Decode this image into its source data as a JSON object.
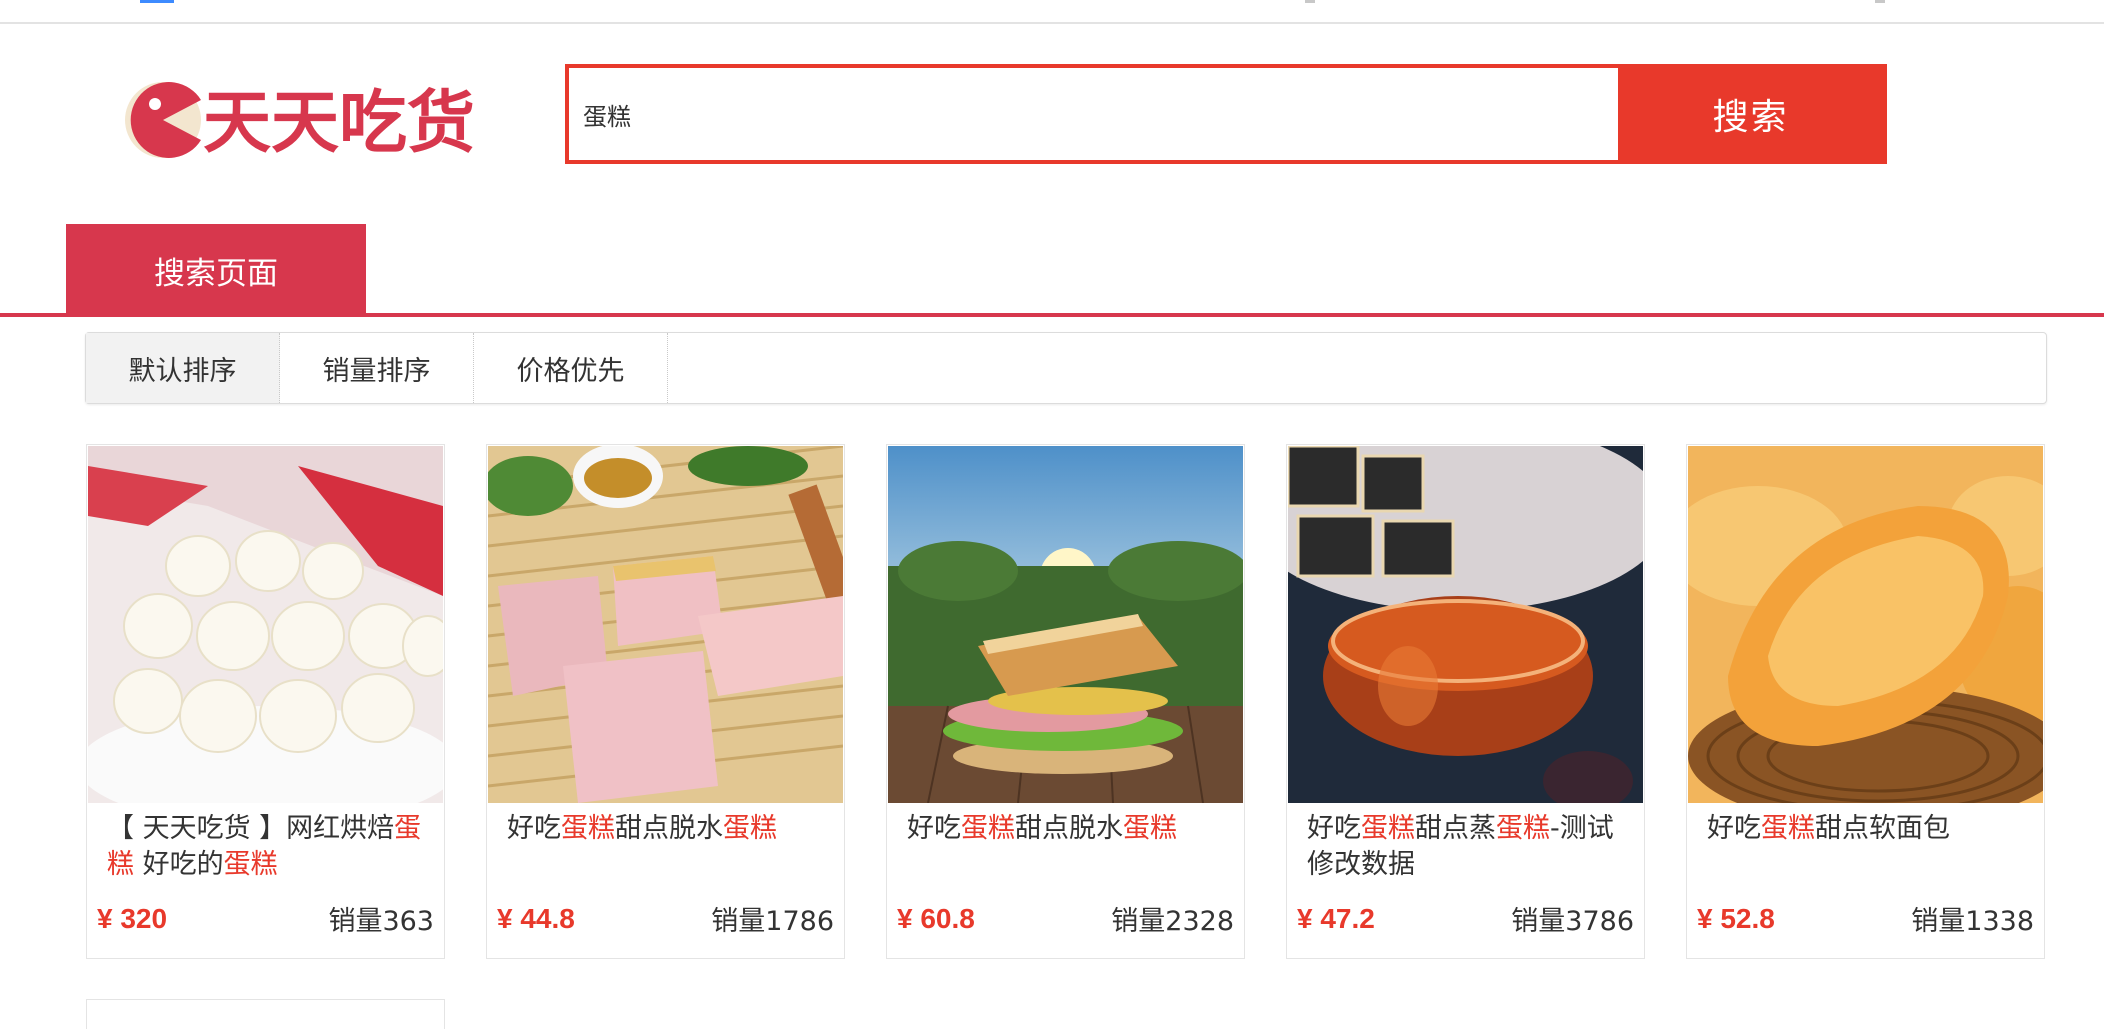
{
  "search": {
    "query": "蛋糕",
    "button_label": "搜索"
  },
  "logo": {
    "text": "天天吃货",
    "color": "#d7374d"
  },
  "tabs": [
    {
      "label": "搜索页面",
      "active": true
    }
  ],
  "sort_options": [
    {
      "label": "默认排序",
      "active": true
    },
    {
      "label": "销量排序",
      "active": false
    },
    {
      "label": "价格优先",
      "active": false
    }
  ],
  "products": [
    {
      "title_parts": [
        {
          "text": "【 天天吃货 】网红烘焙",
          "hl": false
        },
        {
          "text": "蛋糕",
          "hl": true
        },
        {
          "text": " 好吃的",
          "hl": false
        },
        {
          "text": "蛋糕",
          "hl": true
        }
      ],
      "price": "¥ 320",
      "sales": "销量363",
      "image": "milk-candy-photo"
    },
    {
      "title_parts": [
        {
          "text": "好吃",
          "hl": false
        },
        {
          "text": "蛋糕",
          "hl": true
        },
        {
          "text": "甜点脱水",
          "hl": false
        },
        {
          "text": "蛋糕",
          "hl": true
        }
      ],
      "price": "¥ 44.8",
      "sales": "销量1786",
      "image": "sponge-cake-photo"
    },
    {
      "title_parts": [
        {
          "text": "好吃",
          "hl": false
        },
        {
          "text": "蛋糕",
          "hl": true
        },
        {
          "text": "甜点脱水",
          "hl": false
        },
        {
          "text": "蛋糕",
          "hl": true
        }
      ],
      "price": "¥ 60.8",
      "sales": "销量2328",
      "image": "sandwich-photo"
    },
    {
      "title_parts": [
        {
          "text": "好吃",
          "hl": false
        },
        {
          "text": "蛋糕",
          "hl": true
        },
        {
          "text": "甜点蒸",
          "hl": false
        },
        {
          "text": "蛋糕",
          "hl": true
        },
        {
          "text": "-测试修改数据",
          "hl": false
        }
      ],
      "price": "¥ 47.2",
      "sales": "销量3786",
      "image": "honey-bowl-photo"
    },
    {
      "title_parts": [
        {
          "text": "好吃",
          "hl": false
        },
        {
          "text": "蛋糕",
          "hl": true
        },
        {
          "text": "甜点软面包",
          "hl": false
        }
      ],
      "price": "¥ 52.8",
      "sales": "销量1338",
      "image": "pastry-bread-photo"
    }
  ],
  "colors": {
    "accent": "#e8392b",
    "tab": "#d7374d",
    "highlight": "#e8392b"
  }
}
